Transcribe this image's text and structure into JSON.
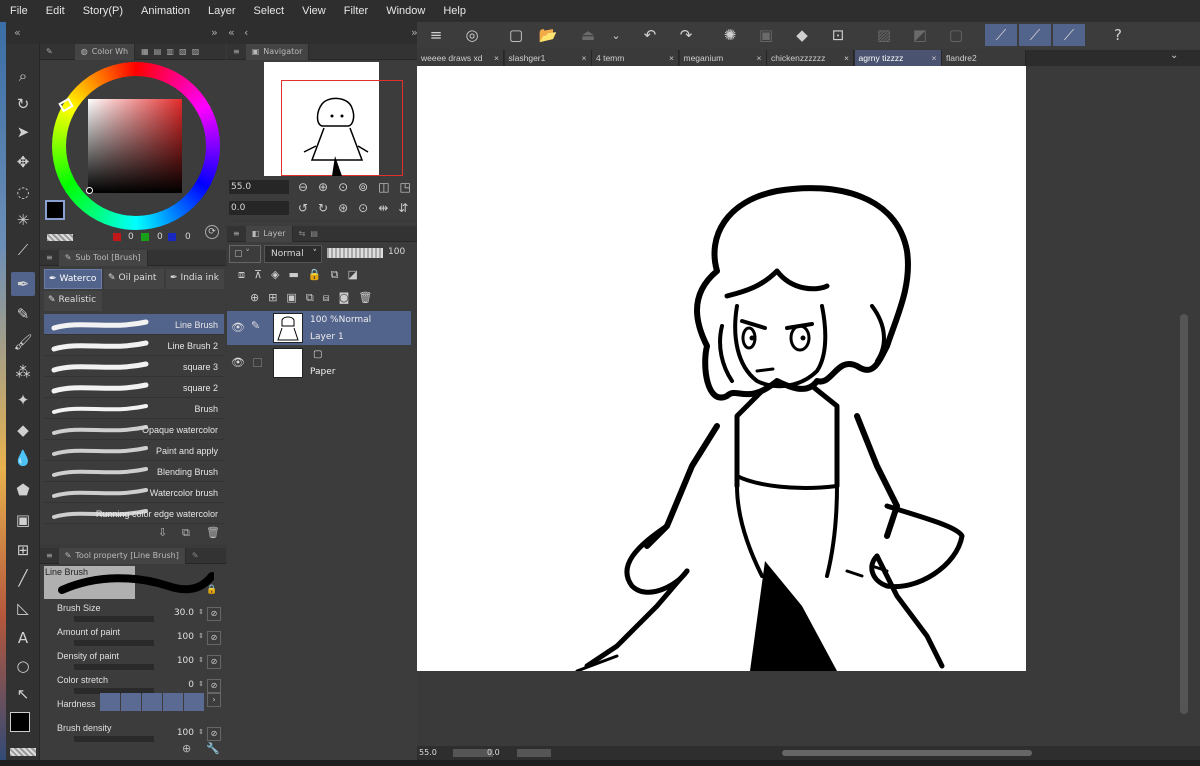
{
  "menu": [
    "File",
    "Edit",
    "Story(P)",
    "Animation",
    "Layer",
    "Select",
    "View",
    "Filter",
    "Window",
    "Help"
  ],
  "color_panel": {
    "tab_label": "Color Wh",
    "rgb_values": [
      "0",
      "0",
      "0"
    ],
    "main_color": "#000000",
    "sub_color": "#ffffff"
  },
  "navigator": {
    "tab_label": "Navigator",
    "zoom_value": "55.0",
    "rotate_value": "0.0"
  },
  "subtool": {
    "header": "Sub Tool [Brush]",
    "groups": [
      "Waterco",
      "Oil paint",
      "India ink",
      "Realistic"
    ],
    "brushes": [
      "Line Brush",
      "Line Brush 2",
      "square 3",
      "square 2",
      "Brush",
      "Opaque watercolor",
      "Paint and apply",
      "Blending Brush",
      "Watercolor brush",
      "Running color edge watercolor"
    ]
  },
  "tool_property": {
    "header": "Tool property [Line Brush]",
    "preview_label": "Line Brush",
    "props": [
      {
        "label": "Brush Size",
        "value": "30.0"
      },
      {
        "label": "Amount of paint",
        "value": "100"
      },
      {
        "label": "Density of paint",
        "value": "100"
      },
      {
        "label": "Color stretch",
        "value": "0"
      },
      {
        "label": "Hardness",
        "value": ""
      },
      {
        "label": "Brush density",
        "value": "100"
      }
    ]
  },
  "layer_panel": {
    "tab_label": "Layer",
    "blend_mode": "Normal",
    "opacity": "100",
    "layers": [
      {
        "info": "100 %Normal",
        "name": "Layer 1",
        "selected": true
      },
      {
        "info": "",
        "name": "Paper",
        "selected": false
      }
    ]
  },
  "doc_tabs": [
    "weeee draws xd",
    "slashger1",
    "4 temm",
    "meganium",
    "chickenzzzzzz",
    "agrny tizzzz",
    "flandre2"
  ],
  "active_tab_index": 5,
  "status": {
    "zoom": "55.0",
    "rotate": "0.0"
  }
}
